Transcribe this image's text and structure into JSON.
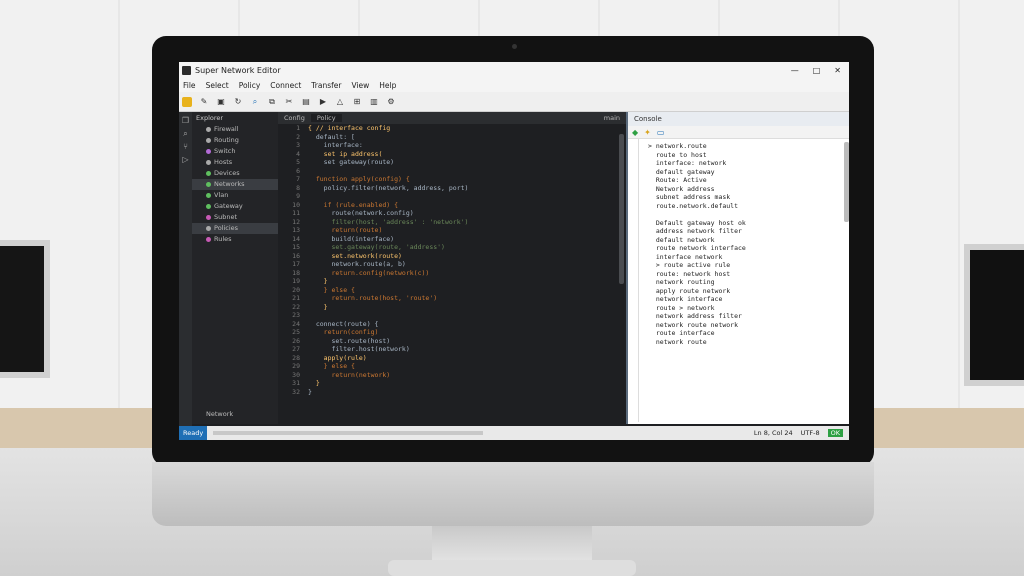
{
  "window": {
    "title": "Super Network Editor"
  },
  "menu": [
    "File",
    "Select",
    "Policy",
    "Connect",
    "Transfer",
    "View",
    "Help"
  ],
  "explorer": {
    "header": "Explorer",
    "items": [
      {
        "label": "Firewall",
        "color": "#aaaaaa"
      },
      {
        "label": "Routing",
        "color": "#aaaaaa"
      },
      {
        "label": "Switch",
        "color": "#b36bd6"
      },
      {
        "label": "Hosts",
        "color": "#aaaaaa"
      },
      {
        "label": "Devices",
        "color": "#5fbf5f"
      },
      {
        "label": "Networks",
        "color": "#5fbf5f"
      },
      {
        "label": "Vlan",
        "color": "#5fbf5f"
      },
      {
        "label": "Gateway",
        "color": "#5fbf5f"
      },
      {
        "label": "Subnet",
        "color": "#c75ab5"
      },
      {
        "label": "Policies",
        "color": "#aaaaaa"
      },
      {
        "label": "Rules",
        "color": "#c75ab5"
      }
    ],
    "footer": "Network"
  },
  "tabs": [
    "Config",
    "Policy",
    "main"
  ],
  "editor": {
    "lines": [
      "{ // interface config",
      "  default: [",
      "    interface:",
      "    set ip address(",
      "    set gateway(route)",
      "",
      "  function apply(config) {",
      "    policy.filter(network, address, port)",
      "",
      "    if (rule.enabled) {",
      "      route(network.config)",
      "      filter(host, 'address' : 'network')",
      "      return(route)",
      "      build(interface)",
      "      set.gateway(route, 'address')",
      "      set.network(route)",
      "      network.route(a, b)",
      "      return.config(network(c))",
      "    }",
      "    } else {",
      "      return.route(host, 'route')",
      "    }",
      "",
      "  connect(route) {",
      "    return(config)",
      "      set.route(host)",
      "      filter.host(network)",
      "    apply(rule)",
      "    } else {",
      "      return(network)",
      "  }",
      "}"
    ]
  },
  "preview": {
    "title": "Console",
    "lines": [
      "> network.route",
      "  route to host",
      "  interface: network",
      "  default gateway",
      "  Route: Active",
      "  Network address",
      "  subnet address mask",
      "  route.network.default",
      "",
      "  Default gateway host ok",
      "  address network filter",
      "  default network",
      "  route network interface",
      "  interface network",
      "  > route active rule",
      "  route: network host",
      "  network routing",
      "  apply route network",
      "  network interface",
      "  route > network",
      "  network address filter",
      "  network route network",
      "  route interface",
      "  network route"
    ]
  },
  "statusbar": {
    "left": "Ready",
    "position": "Ln 8, Col 24",
    "encoding": "UTF-8",
    "status": "OK"
  }
}
